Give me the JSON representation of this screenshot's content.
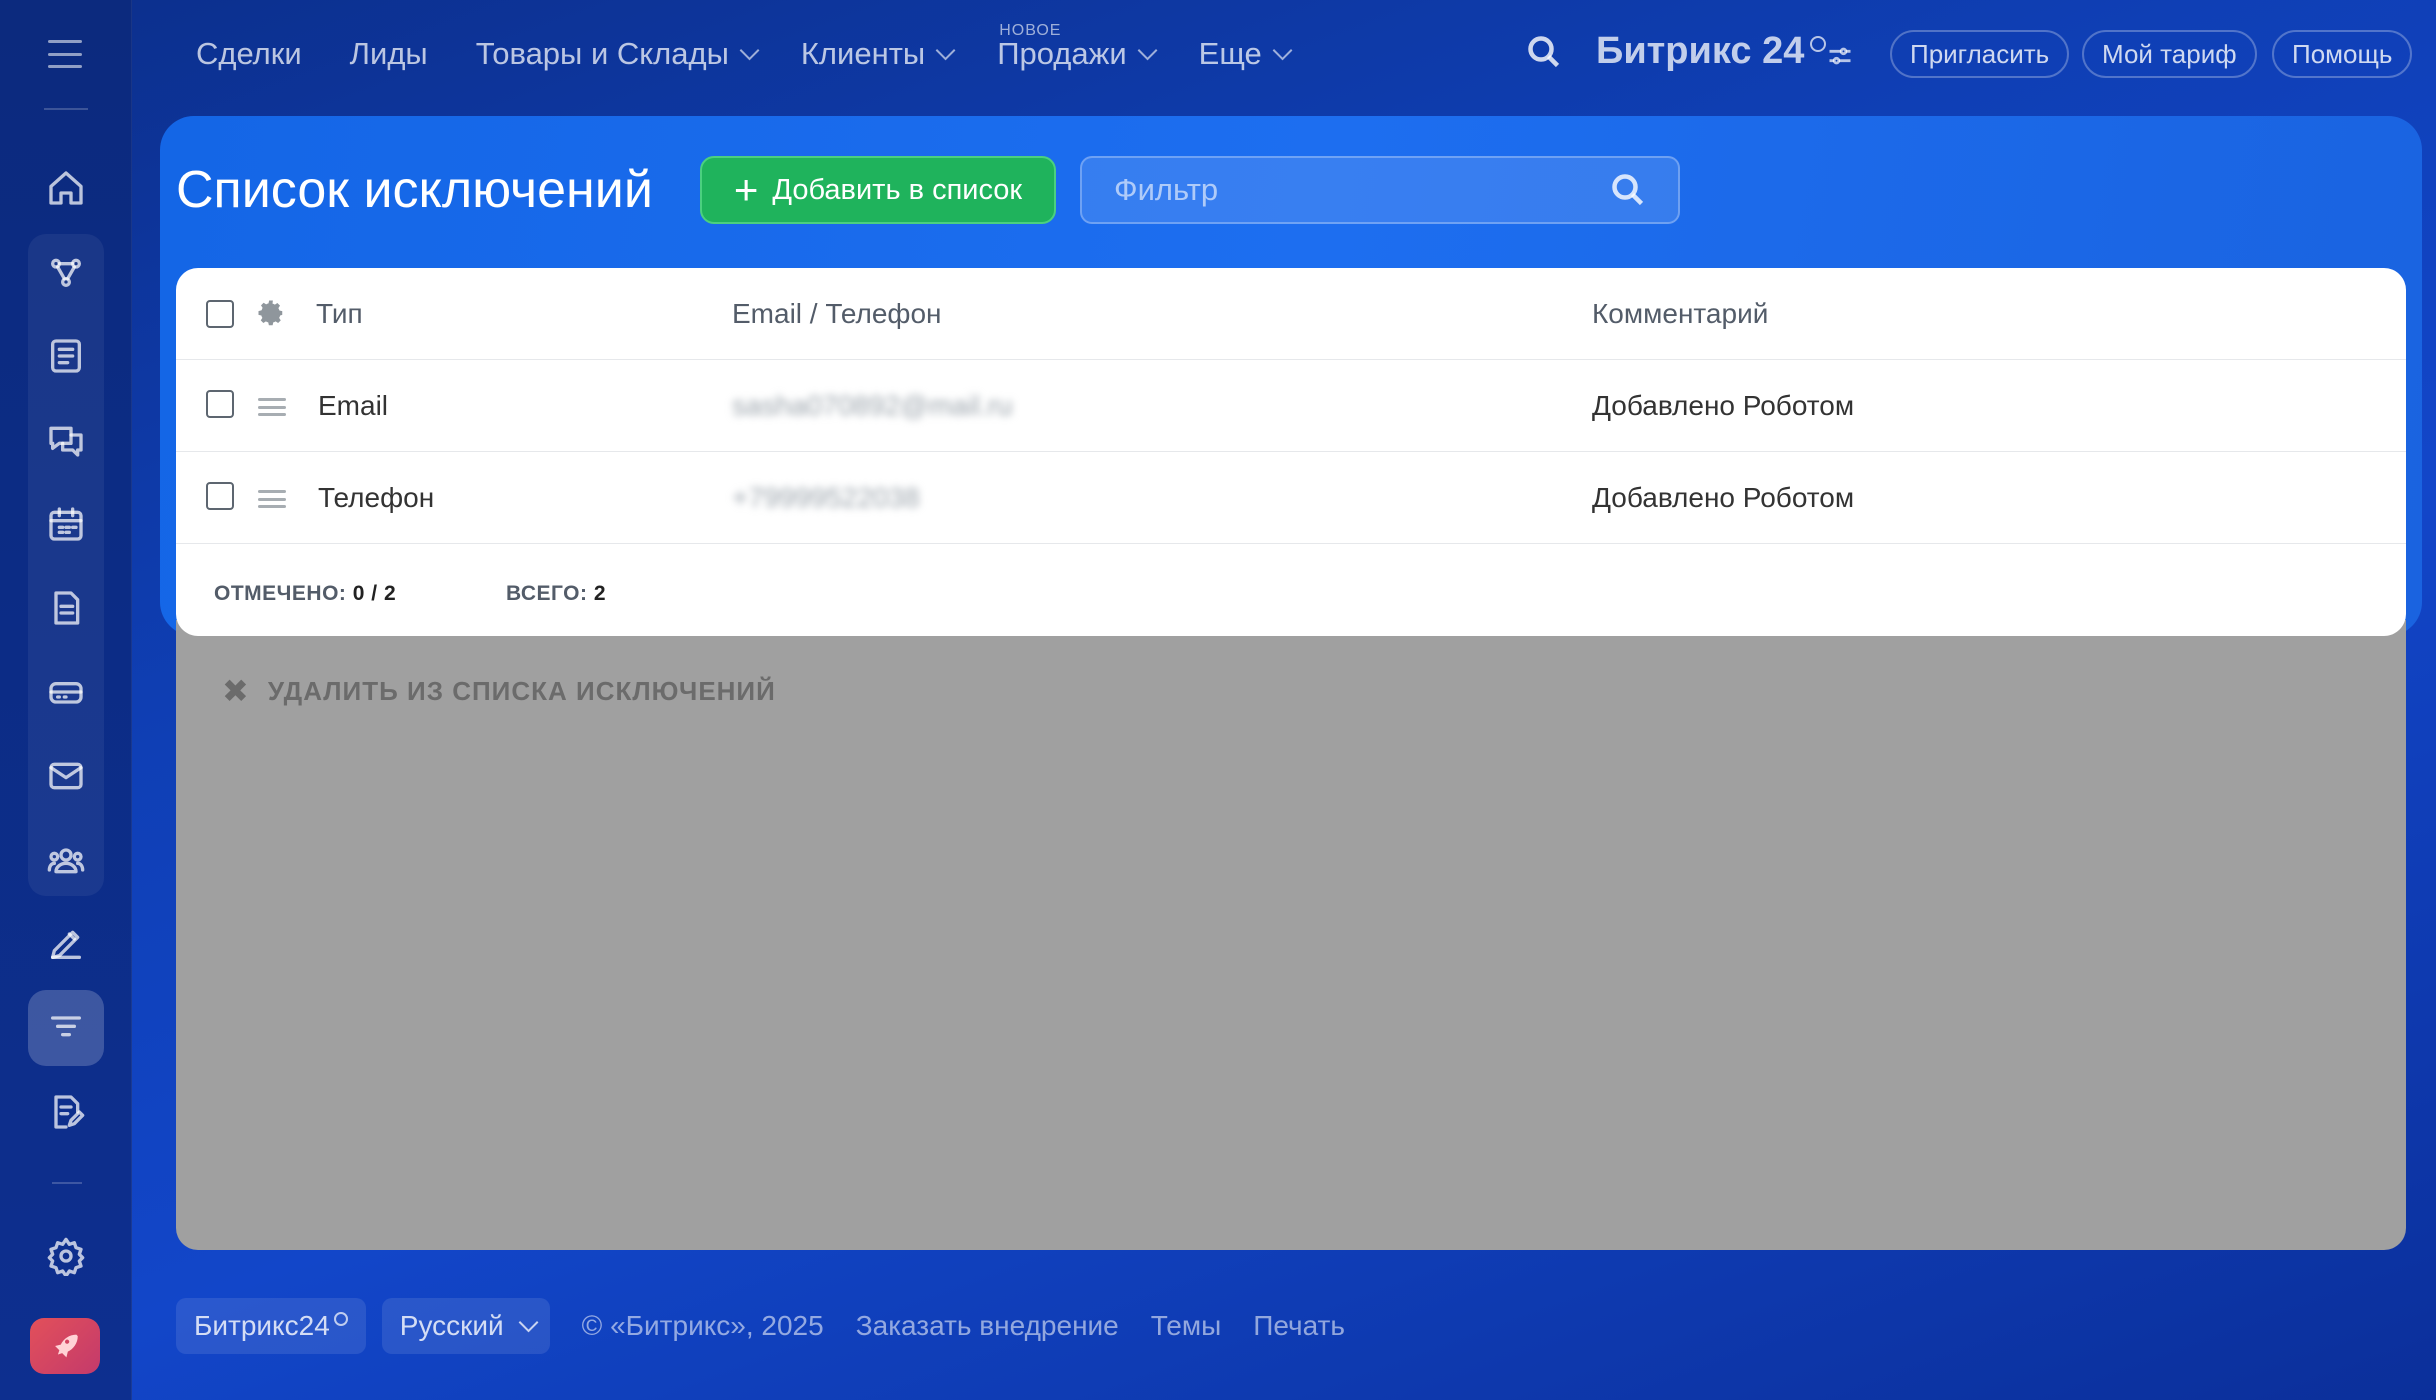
{
  "nav": {
    "items": [
      {
        "label": "Сделки",
        "dropdown": false,
        "badge": ""
      },
      {
        "label": "Лиды",
        "dropdown": false,
        "badge": ""
      },
      {
        "label": "Товары и Склады",
        "dropdown": true,
        "badge": ""
      },
      {
        "label": "Клиенты",
        "dropdown": true,
        "badge": ""
      },
      {
        "label": "Продажи",
        "dropdown": true,
        "badge": "НОВОЕ"
      },
      {
        "label": "Еще",
        "dropdown": true,
        "badge": ""
      }
    ],
    "brand": "Битрикс 24",
    "invite": "Пригласить",
    "tariff": "Мой тариф",
    "help": "Помощь"
  },
  "sidebar": {
    "icons": [
      "home-icon",
      "crm-icon",
      "document-list-icon",
      "chat-icon",
      "calendar-icon",
      "file-icon",
      "drive-icon",
      "mail-icon",
      "contacts-icon",
      "pen-icon",
      "filter-list-icon",
      "form-edit-icon",
      "settings-icon",
      "rocket-icon"
    ],
    "active": "filter-list-icon"
  },
  "page": {
    "title": "Список исключений",
    "add_button": "Добавить в список",
    "filter_placeholder": "Фильтр"
  },
  "table": {
    "columns": [
      "Тип",
      "Email / Телефон",
      "Комментарий"
    ],
    "rows": [
      {
        "type": "Email",
        "value": "sasha070892@mail.ru",
        "comment": "Добавлено Роботом"
      },
      {
        "type": "Телефон",
        "value": "+79999522038",
        "comment": "Добавлено Роботом"
      }
    ],
    "footer": {
      "selected_label": "ОТМЕЧЕНО:",
      "selected_value": "0 / 2",
      "total_label": "ВСЕГО:",
      "total_value": "2"
    }
  },
  "actions": {
    "remove_label": "УДАЛИТЬ ИЗ СПИСКА ИСКЛЮЧЕНИЙ"
  },
  "footer": {
    "brand": "Битрикс24",
    "language": "Русский",
    "copyright": "© «Битрикс», 2025",
    "order": "Заказать внедрение",
    "themes": "Темы",
    "print": "Печать"
  },
  "colors": {
    "accent_green": "#1fb35c",
    "panel_blue": "#1466e6",
    "background_blue": "#0f3fb5"
  }
}
